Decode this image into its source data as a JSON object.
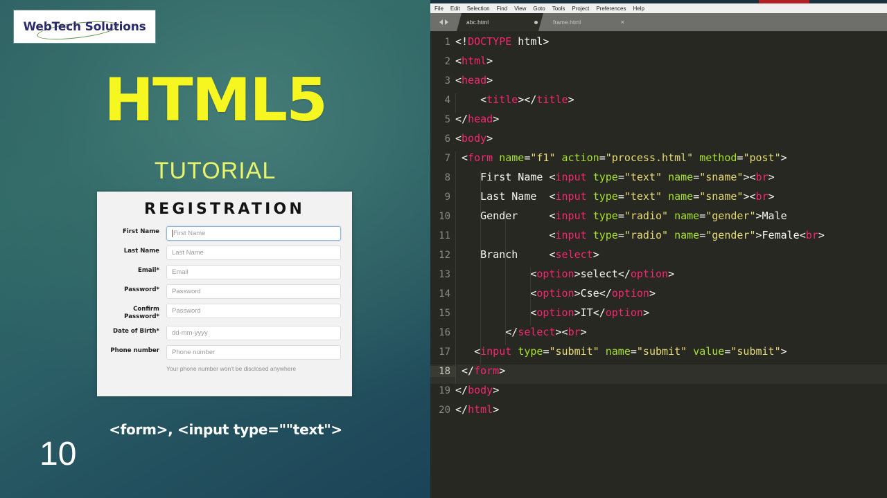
{
  "slide": {
    "logo_text": "WebTech Solutions",
    "title": "HTML5",
    "subtitle": "TUTORIAL",
    "caption": "<form>, <input type=\"\"text\">",
    "page_number": "10",
    "colors": {
      "accent_yellow": "#f6f621",
      "subtitle_yellow": "#e9f36a",
      "bg_teal": "#2f6a67",
      "bg_deep": "#1c4357",
      "logo_text": "#2b2a6b",
      "logo_swoosh": "#5d8f3f"
    },
    "form": {
      "heading": "REGISTRATION",
      "fields": [
        {
          "label": "First Name",
          "placeholder": "First Name",
          "focused": true
        },
        {
          "label": "Last Name",
          "placeholder": "Last Name",
          "focused": false
        },
        {
          "label": "Email*",
          "placeholder": "Email",
          "focused": false
        },
        {
          "label": "Password*",
          "placeholder": "Password",
          "focused": false
        },
        {
          "label": "Confirm\nPassword*",
          "placeholder": "Password",
          "focused": false
        },
        {
          "label": "Date of Birth*",
          "placeholder": "dd-mm-yyyy",
          "focused": false
        },
        {
          "label": "Phone number",
          "placeholder": "Phone number",
          "focused": false
        }
      ],
      "hint": "Your phone number won't be disclosed anywhere"
    }
  },
  "editor": {
    "menu": [
      "File",
      "Edit",
      "Selection",
      "Find",
      "View",
      "Goto",
      "Tools",
      "Project",
      "Preferences",
      "Help"
    ],
    "tabs": [
      {
        "title": "abc.html",
        "state": "active",
        "indicator": "modified-dot"
      },
      {
        "title": "frame.html",
        "state": "inactive",
        "indicator": "close-x",
        "close_label": "×"
      }
    ],
    "nav_icons": [
      "arrow-left",
      "arrow-right"
    ],
    "current_line": 18,
    "colors": {
      "background": "#272822",
      "tag": "#f92672",
      "attribute": "#a6e22e",
      "value": "#e6db74",
      "plain": "#f8f8f2",
      "gutter": "#8a8a82",
      "tabbar": "#6e6e6b",
      "menubar": "#f0f0f0",
      "topstrip": "#1b3140",
      "topstrip_red": "#b02026"
    },
    "lines": [
      {
        "n": "1",
        "indent": 0,
        "tokens": [
          {
            "c": "punc",
            "t": "<!"
          },
          {
            "c": "doctype",
            "t": "DOCTYPE"
          },
          {
            "c": "punc",
            "t": " html>"
          }
        ]
      },
      {
        "n": "2",
        "indent": 0,
        "tokens": [
          {
            "c": "punc",
            "t": "<"
          },
          {
            "c": "tag",
            "t": "html"
          },
          {
            "c": "punc",
            "t": ">"
          }
        ]
      },
      {
        "n": "3",
        "indent": 0,
        "tokens": [
          {
            "c": "punc",
            "t": "<"
          },
          {
            "c": "tag",
            "t": "head"
          },
          {
            "c": "punc",
            "t": ">"
          }
        ]
      },
      {
        "n": "4",
        "indent": 1,
        "tokens": [
          {
            "c": "text",
            "t": "    "
          },
          {
            "c": "punc",
            "t": "<"
          },
          {
            "c": "tag",
            "t": "title"
          },
          {
            "c": "punc",
            "t": "></"
          },
          {
            "c": "tag",
            "t": "title"
          },
          {
            "c": "punc",
            "t": ">"
          }
        ]
      },
      {
        "n": "5",
        "indent": 0,
        "tokens": [
          {
            "c": "punc",
            "t": "</"
          },
          {
            "c": "tag",
            "t": "head"
          },
          {
            "c": "punc",
            "t": ">"
          }
        ]
      },
      {
        "n": "6",
        "indent": 0,
        "tokens": [
          {
            "c": "punc",
            "t": "<"
          },
          {
            "c": "tag",
            "t": "body"
          },
          {
            "c": "punc",
            "t": ">"
          }
        ]
      },
      {
        "n": "7",
        "indent": 1,
        "tokens": [
          {
            "c": "text",
            "t": " "
          },
          {
            "c": "punc",
            "t": "<"
          },
          {
            "c": "tagu",
            "t": "form"
          },
          {
            "c": "text",
            "t": " "
          },
          {
            "c": "attr",
            "t": "name"
          },
          {
            "c": "punc",
            "t": "="
          },
          {
            "c": "val",
            "t": "\"f1\""
          },
          {
            "c": "text",
            "t": " "
          },
          {
            "c": "attr",
            "t": "action"
          },
          {
            "c": "punc",
            "t": "="
          },
          {
            "c": "val",
            "t": "\"process.html\""
          },
          {
            "c": "text",
            "t": " "
          },
          {
            "c": "attr",
            "t": "method"
          },
          {
            "c": "punc",
            "t": "="
          },
          {
            "c": "val",
            "t": "\"post\""
          },
          {
            "c": "punc",
            "t": ">"
          }
        ]
      },
      {
        "n": "8",
        "indent": 2,
        "tokens": [
          {
            "c": "text",
            "t": "    First Name "
          },
          {
            "c": "punc",
            "t": "<"
          },
          {
            "c": "tag",
            "t": "input"
          },
          {
            "c": "text",
            "t": " "
          },
          {
            "c": "attr",
            "t": "type"
          },
          {
            "c": "punc",
            "t": "="
          },
          {
            "c": "val",
            "t": "\"text\""
          },
          {
            "c": "text",
            "t": " "
          },
          {
            "c": "attr",
            "t": "name"
          },
          {
            "c": "punc",
            "t": "="
          },
          {
            "c": "val",
            "t": "\"sname\""
          },
          {
            "c": "punc",
            "t": "><"
          },
          {
            "c": "tag",
            "t": "br"
          },
          {
            "c": "punc",
            "t": ">"
          }
        ]
      },
      {
        "n": "9",
        "indent": 2,
        "tokens": [
          {
            "c": "text",
            "t": "    Last Name  "
          },
          {
            "c": "punc",
            "t": "<"
          },
          {
            "c": "tag",
            "t": "input"
          },
          {
            "c": "text",
            "t": " "
          },
          {
            "c": "attr",
            "t": "type"
          },
          {
            "c": "punc",
            "t": "="
          },
          {
            "c": "val",
            "t": "\"text\""
          },
          {
            "c": "text",
            "t": " "
          },
          {
            "c": "attr",
            "t": "name"
          },
          {
            "c": "punc",
            "t": "="
          },
          {
            "c": "val",
            "t": "\"sname\""
          },
          {
            "c": "punc",
            "t": "><"
          },
          {
            "c": "tag",
            "t": "br"
          },
          {
            "c": "punc",
            "t": ">"
          }
        ]
      },
      {
        "n": "10",
        "indent": 3,
        "tokens": [
          {
            "c": "text",
            "t": "    Gender     "
          },
          {
            "c": "punc",
            "t": "<"
          },
          {
            "c": "tag",
            "t": "input"
          },
          {
            "c": "text",
            "t": " "
          },
          {
            "c": "attr",
            "t": "type"
          },
          {
            "c": "punc",
            "t": "="
          },
          {
            "c": "val",
            "t": "\"radio\""
          },
          {
            "c": "text",
            "t": " "
          },
          {
            "c": "attr",
            "t": "name"
          },
          {
            "c": "punc",
            "t": "="
          },
          {
            "c": "val",
            "t": "\"gender\""
          },
          {
            "c": "punc",
            "t": ">"
          },
          {
            "c": "text",
            "t": "Male"
          }
        ]
      },
      {
        "n": "11",
        "indent": 3,
        "tokens": [
          {
            "c": "text",
            "t": "               "
          },
          {
            "c": "punc",
            "t": "<"
          },
          {
            "c": "tag",
            "t": "input"
          },
          {
            "c": "text",
            "t": " "
          },
          {
            "c": "attr",
            "t": "type"
          },
          {
            "c": "punc",
            "t": "="
          },
          {
            "c": "val",
            "t": "\"radio\""
          },
          {
            "c": "text",
            "t": " "
          },
          {
            "c": "attr",
            "t": "name"
          },
          {
            "c": "punc",
            "t": "="
          },
          {
            "c": "val",
            "t": "\"gender\""
          },
          {
            "c": "punc",
            "t": ">"
          },
          {
            "c": "text",
            "t": "Female"
          },
          {
            "c": "punc",
            "t": "<"
          },
          {
            "c": "tag",
            "t": "br"
          },
          {
            "c": "punc",
            "t": ">"
          }
        ]
      },
      {
        "n": "12",
        "indent": 3,
        "tokens": [
          {
            "c": "text",
            "t": "    Branch     "
          },
          {
            "c": "punc",
            "t": "<"
          },
          {
            "c": "tag",
            "t": "select"
          },
          {
            "c": "punc",
            "t": ">"
          }
        ]
      },
      {
        "n": "13",
        "indent": 4,
        "tokens": [
          {
            "c": "text",
            "t": "            "
          },
          {
            "c": "punc",
            "t": "<"
          },
          {
            "c": "tag",
            "t": "option"
          },
          {
            "c": "punc",
            "t": ">"
          },
          {
            "c": "text",
            "t": "select"
          },
          {
            "c": "punc",
            "t": "</"
          },
          {
            "c": "tag",
            "t": "option"
          },
          {
            "c": "punc",
            "t": ">"
          }
        ]
      },
      {
        "n": "14",
        "indent": 4,
        "tokens": [
          {
            "c": "text",
            "t": "            "
          },
          {
            "c": "punc",
            "t": "<"
          },
          {
            "c": "tag",
            "t": "option"
          },
          {
            "c": "punc",
            "t": ">"
          },
          {
            "c": "text",
            "t": "Cse"
          },
          {
            "c": "punc",
            "t": "</"
          },
          {
            "c": "tag",
            "t": "option"
          },
          {
            "c": "punc",
            "t": ">"
          }
        ]
      },
      {
        "n": "15",
        "indent": 4,
        "tokens": [
          {
            "c": "text",
            "t": "            "
          },
          {
            "c": "punc",
            "t": "<"
          },
          {
            "c": "tag",
            "t": "option"
          },
          {
            "c": "punc",
            "t": ">"
          },
          {
            "c": "text",
            "t": "IT"
          },
          {
            "c": "punc",
            "t": "</"
          },
          {
            "c": "tag",
            "t": "option"
          },
          {
            "c": "punc",
            "t": ">"
          }
        ]
      },
      {
        "n": "16",
        "indent": 3,
        "tokens": [
          {
            "c": "text",
            "t": "        "
          },
          {
            "c": "punc",
            "t": "</"
          },
          {
            "c": "tag",
            "t": "select"
          },
          {
            "c": "punc",
            "t": "><"
          },
          {
            "c": "tag",
            "t": "br"
          },
          {
            "c": "punc",
            "t": ">"
          }
        ]
      },
      {
        "n": "17",
        "indent": 2,
        "tokens": [
          {
            "c": "text",
            "t": "   "
          },
          {
            "c": "punc",
            "t": "<"
          },
          {
            "c": "tag",
            "t": "input"
          },
          {
            "c": "text",
            "t": " "
          },
          {
            "c": "attr",
            "t": "type"
          },
          {
            "c": "punc",
            "t": "="
          },
          {
            "c": "val",
            "t": "\"submit\""
          },
          {
            "c": "text",
            "t": " "
          },
          {
            "c": "attr",
            "t": "name"
          },
          {
            "c": "punc",
            "t": "="
          },
          {
            "c": "val",
            "t": "\"submit\""
          },
          {
            "c": "text",
            "t": " "
          },
          {
            "c": "attr",
            "t": "value"
          },
          {
            "c": "punc",
            "t": "="
          },
          {
            "c": "val",
            "t": "\"submit\""
          },
          {
            "c": "punc",
            "t": ">"
          }
        ]
      },
      {
        "n": "18",
        "indent": 1,
        "tokens": [
          {
            "c": "text",
            "t": " "
          },
          {
            "c": "punc",
            "t": "</"
          },
          {
            "c": "tagu",
            "t": "form"
          },
          {
            "c": "punc",
            "t": ">"
          }
        ]
      },
      {
        "n": "19",
        "indent": 0,
        "tokens": [
          {
            "c": "punc",
            "t": "</"
          },
          {
            "c": "tag",
            "t": "body"
          },
          {
            "c": "punc",
            "t": ">"
          }
        ]
      },
      {
        "n": "20",
        "indent": 0,
        "tokens": [
          {
            "c": "punc",
            "t": "</"
          },
          {
            "c": "tag",
            "t": "html"
          },
          {
            "c": "punc",
            "t": ">"
          }
        ]
      }
    ]
  }
}
